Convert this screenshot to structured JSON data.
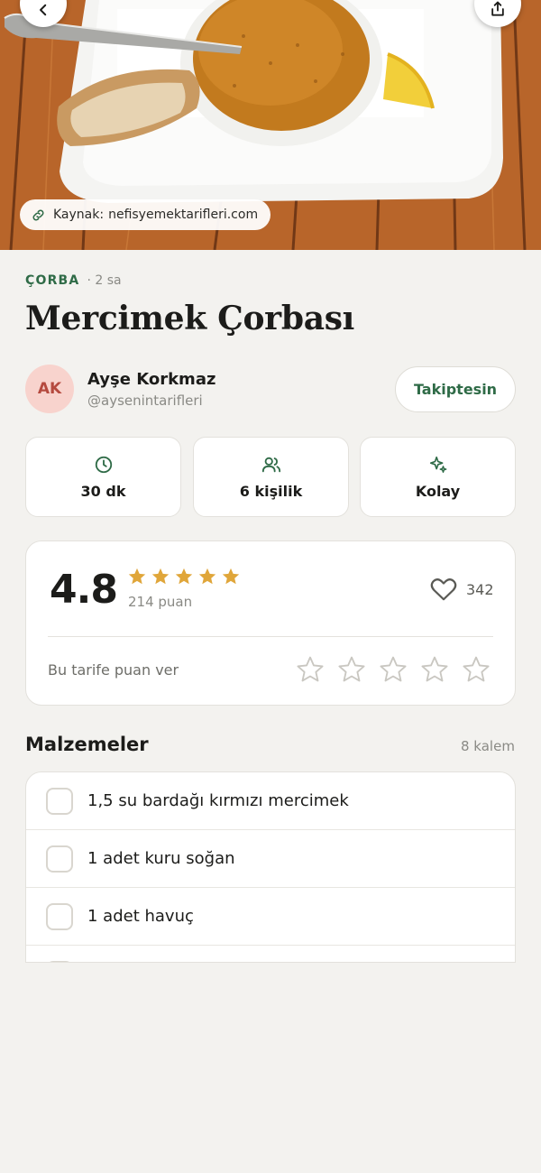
{
  "hero": {
    "source_prefix": "Kaynak:",
    "source_domain": "nefisyemektarifleri.com",
    "back_icon": "chevron-left-icon",
    "share_icon": "share-icon",
    "link_icon": "link-icon"
  },
  "recipe": {
    "category": "ÇORBA",
    "time_ago": "· 2 sa",
    "title": "Mercimek Çorbası"
  },
  "author": {
    "initials": "AK",
    "name": "Ayşe Korkmaz",
    "handle": "@aysenintarifleri",
    "follow_label": "Takiptesin"
  },
  "stats": [
    {
      "icon": "clock-icon",
      "label": "30 dk"
    },
    {
      "icon": "users-icon",
      "label": "6 kişilik"
    },
    {
      "icon": "sparkles-icon",
      "label": "Kolay"
    }
  ],
  "rating": {
    "value": "4.8",
    "stars_filled": 5,
    "count_label": "214 puan",
    "likes": "342",
    "rate_prompt": "Bu tarife puan ver"
  },
  "ingredients": {
    "title": "Malzemeler",
    "count_label": "8 kalem",
    "items": [
      "1,5 su bardağı kırmızı mercimek",
      "1 adet kuru soğan",
      "1 adet havuç"
    ]
  },
  "colors": {
    "accent_green": "#2f6b47",
    "star_gold": "#e0a63a",
    "avatar_bg": "#f8d3cd",
    "page_bg": "#f3f2ef"
  }
}
